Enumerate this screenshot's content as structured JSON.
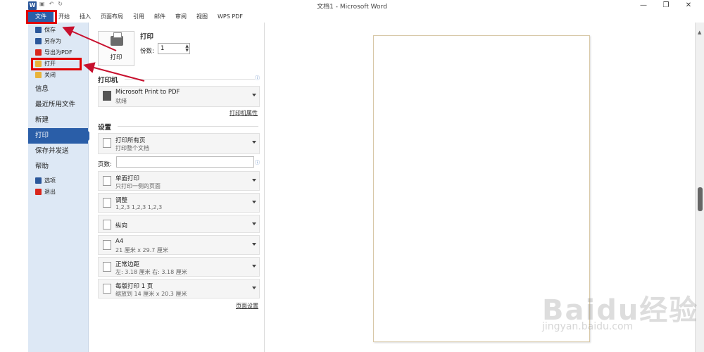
{
  "window": {
    "title": "文档1 - Microsoft Word",
    "app_icon": "W",
    "qat_icons": [
      "save-icon",
      "undo-icon",
      "redo-icon"
    ],
    "controls": [
      "—",
      "❐",
      "✕"
    ]
  },
  "ribbon": {
    "tabs": [
      "文件",
      "开始",
      "插入",
      "页面布局",
      "引用",
      "邮件",
      "审阅",
      "视图",
      "WPS PDF"
    ]
  },
  "nav": {
    "small_items": [
      {
        "label": "保存",
        "icon": "save-icon",
        "color": "#2b579a"
      },
      {
        "label": "另存为",
        "icon": "save-as-icon",
        "color": "#2b579a"
      },
      {
        "label": "导出为PDF",
        "icon": "pdf-icon",
        "color": "#d9261c"
      },
      {
        "label": "打开",
        "icon": "open-folder-icon",
        "color": "#e8b33a"
      },
      {
        "label": "关闭",
        "icon": "close-folder-icon",
        "color": "#e8b33a"
      }
    ],
    "big_items": [
      "信息",
      "最近所用文件",
      "新建",
      "打印",
      "保存并发送",
      "帮助"
    ],
    "active": "打印",
    "footer_items": [
      {
        "label": "选项",
        "icon": "options-icon",
        "color": "#2b579a"
      },
      {
        "label": "退出",
        "icon": "exit-icon",
        "color": "#d9261c"
      }
    ]
  },
  "print": {
    "button_label": "打印",
    "title": "打印",
    "copies_label": "份数:",
    "copies_value": "1",
    "printer_section": "打印机",
    "printer_name": "Microsoft Print to PDF",
    "printer_status": "就绪",
    "printer_props_link": "打印机属性",
    "settings_section": "设置",
    "pages_label": "页数:",
    "page_setup_link": "页面设置",
    "settings": [
      {
        "t1": "打印所有页",
        "t2": "打印整个文档",
        "icon": "pages-icon"
      },
      {
        "t1": "单面打印",
        "t2": "只打印一侧的页面",
        "icon": "one-sided-icon"
      },
      {
        "t1": "调整",
        "t2": "1,2,3    1,2,3    1,2,3",
        "icon": "collate-icon"
      },
      {
        "t1": "纵向",
        "t2": "",
        "icon": "portrait-icon"
      },
      {
        "t1": "A4",
        "t2": "21 厘米 x 29.7 厘米",
        "icon": "paper-size-icon"
      },
      {
        "t1": "正常边距",
        "t2": "左: 3.18 厘米    右: 3.18 厘米",
        "icon": "margins-icon"
      },
      {
        "t1": "每版打印 1 页",
        "t2": "缩放到 14 厘米 x 20.3 厘米",
        "icon": "pages-per-sheet-icon"
      }
    ]
  },
  "watermark": {
    "brand": "Baidu经验",
    "url": "jingyan.baidu.com"
  },
  "colors": {
    "accent": "#2a5ea8",
    "highlight": "#e00000",
    "nav_bg": "#dde8f5"
  }
}
